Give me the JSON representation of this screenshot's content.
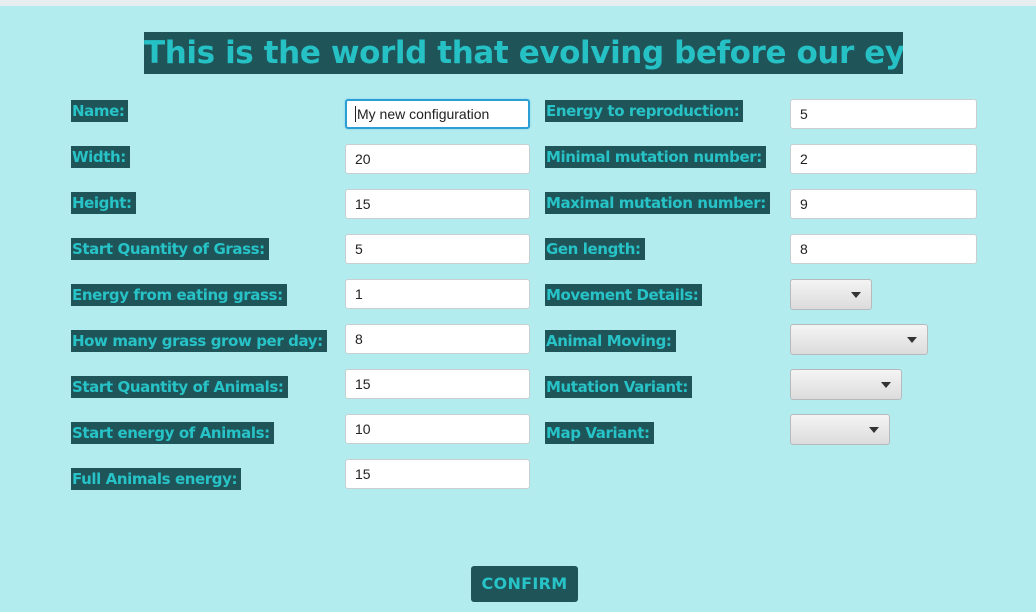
{
  "title": "This is the world that evolving before our eyes!",
  "left_form": [
    {
      "label": "Name:",
      "value": "My new configuration"
    },
    {
      "label": "Width:",
      "value": "20"
    },
    {
      "label": "Height:",
      "value": "15"
    },
    {
      "label": "Start Quantity of Grass:",
      "value": "5"
    },
    {
      "label": "Energy from eating grass:",
      "value": "1"
    },
    {
      "label": "How many grass grow per day:",
      "value": "8"
    },
    {
      "label": "Start Quantity of Animals:",
      "value": "15"
    },
    {
      "label": "Start energy of Animals:",
      "value": "10"
    },
    {
      "label": "Full Animals energy:",
      "value": "15"
    }
  ],
  "right_form": [
    {
      "label": "Energy to reproduction:",
      "value": "5"
    },
    {
      "label": "Minimal mutation number:",
      "value": "2"
    },
    {
      "label": "Maximal mutation number:",
      "value": "9"
    },
    {
      "label": "Gen length:",
      "value": "8"
    },
    {
      "label": "Movement Details:",
      "value": ""
    },
    {
      "label": "Animal Moving:",
      "value": ""
    },
    {
      "label": "Mutation Variant:",
      "value": ""
    },
    {
      "label": "Map Variant:",
      "value": ""
    }
  ],
  "confirm_label": "CONFIRM",
  "colors": {
    "background": "#b2ecee",
    "label_background": "#1f5459",
    "label_text": "#27c3c7",
    "focus_border": "#2b9fd3"
  },
  "icons": {
    "combo_arrow": "chevron-down-icon"
  }
}
